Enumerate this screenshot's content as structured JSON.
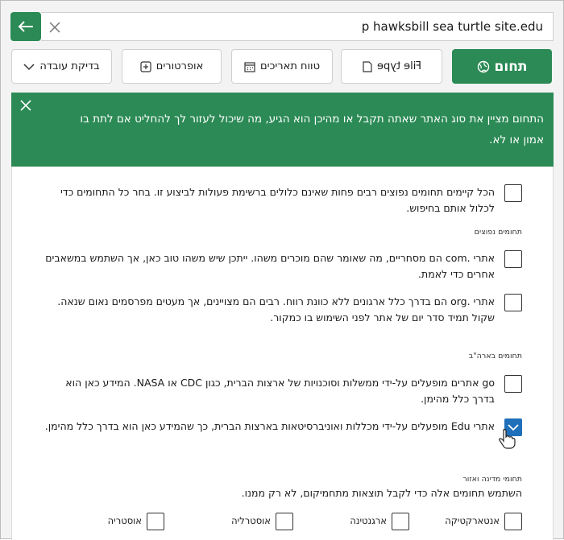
{
  "search": {
    "query": "p hawksbill sea turtle site.edu"
  },
  "toolbar": {
    "domain_label": "תחום",
    "file_type_label": "File type",
    "date_range_label": "טווח תאריכים",
    "operators_label": "אופרטורים",
    "fact_check_label": "בדיקת עובדה"
  },
  "banner": {
    "text": "התחום מציין את סוג האתר שאתה תקבל או מהיכן הוא הגיע, מה שיכול לעזור לך להחליט אם לתת בו אמון או לא."
  },
  "options": {
    "all_domains": "הכל קיימים תחומים נפוצים רבים פחות שאינם כלולים ברשימת פעולות לביצוע זו. בחר כל התחומים כדי לכלול אותם בחיפוש.",
    "common_label": "תחומים נפוצים",
    "com": "אתרי .com הם מסחריים, מה שאומר שהם מוכרים משהו. ייתכן שיש משהו טוב כאן, אך השתמש במשאבים אחרים כדי לאמת.",
    "org": "אתרי .org הם בדרך כלל ארגונים ללא כוונת רווח. רבים הם מצויינים, אך מעטים מפרסמים נאום שנאה. שקול תמיד סדר יום של אתר לפני השימוש בו כמקור.",
    "us_label": "תחומים בארה\"ב",
    "gov": "go אתרים מופעלים על-ידי ממשלות וסוכנויות של ארצות הברית, כגון CDC או NASA. המידע כאן הוא בדרך כלל מהימן.",
    "edu": "אתרי Edu מופעלים על-ידי מכללות ואוניברסיטאות בארצות הברית, כך שהמידע כאן הוא בדרך כלל מהימן.",
    "country_label": "תחומי מדינה ואזור",
    "country_desc": "השתמש תחומים אלה כדי לקבל תוצאות מתחמיקום, לא רק ממנו."
  },
  "countries": [
    "אנטארקטיקה",
    "ארגנטינה",
    "אוסטרליה",
    "אוסטריה"
  ],
  "colors": {
    "accent": "#2b8a55",
    "checked": "#1f6fba"
  }
}
